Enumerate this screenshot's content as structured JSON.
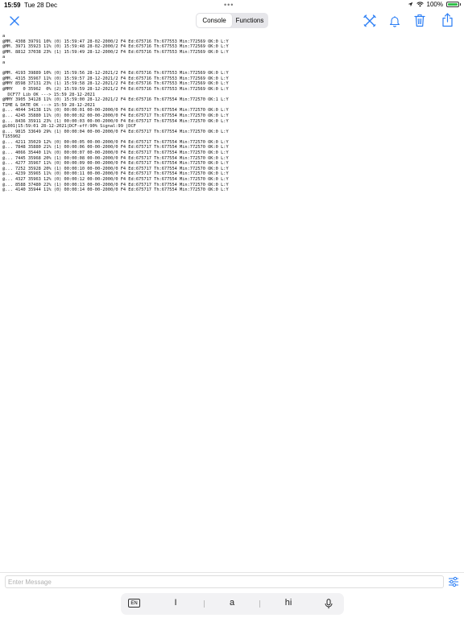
{
  "status_bar": {
    "time": "15:59",
    "date": "Tue 28 Dec",
    "battery": "100%",
    "battery_level": 1.0
  },
  "toolbar": {
    "tabs": [
      {
        "label": "Console",
        "active": true
      },
      {
        "label": "Functions",
        "active": false
      }
    ],
    "accent_color": "#2a7df5"
  },
  "console": {
    "lines": [
      "a",
      "@MM. 4308 39791 10% (0) 15:59:47 28-02-2000/2 F4 Ed:675716 Th:677553 Min:772569 OK:0 L:Y",
      "@MM. 3971 35923 11% (0) 15:59:48 28-02-2000/2 F4 Ed:675716 Th:677553 Min:772569 OK:0 L:Y",
      "@MM. 8812 37038 23% (1) 15:59:49 28-12-2000/2 F4 Ed:675716 Th:677553 Min:772569 OK:0 L:Y",
      "a",
      "a",
      "",
      "@MM. 4193 39889 10% (0) 15:59:56 28-12-2021/2 F4 Ed:675716 Th:677553 Min:772569 OK:0 L:Y",
      "@MM. 4315 35967 11% (0) 15:59:57 28-12-2021/2 F4 Ed:675716 Th:677553 Min:772569 OK:0 L:Y",
      "@MMY 8598 37131 23% (1) 15:59:58 28-12-2021/2 F4 Ed:675716 Th:677553 Min:772569 OK:0 L:Y",
      "@MMY    0 35962  0% (2) 15:59:59 28-12-2021/2 F4 Ed:675716 Th:677553 Min:772569 OK:0 L:Y",
      "  DCF77 Lib OK ---> 15:59 28-12-2021",
      "@MMY 3905 34128 11% (0) 15:59:00 28-12-2021/2 F4 Ed:675716 Th:677554 Min:772570 OK:1 L:Y",
      "TIME & DATE OK ---> 15:59 28-12-2021",
      "@... 4044 34138 11% (0) 00:00:01 00-00-2000/0 F4 Ed:675717 Th:677554 Min:772570 OK:0 L:Y",
      "@... 4245 35880 11% (0) 00:00:02 00-00-2000/0 F4 Ed:675717 Th:677554 Min:772570 OK:0 L:Y",
      "@... 8436 35911 23% (1) 00:00:03 00-00-2000/0 F4 Ed:675717 Th:677554 Min:772570 OK:0 L:Y",
      "@L001|15:59:01 28-12-2021|DCF-eff:90% Signal:99 |DCF",
      "@... 9815 33649 29% (1) 00:00:04 00-00-2000/0 F4 Ed:675717 Th:677554 Min:772570 OK:0 L:Y",
      "T155902",
      "@... 4211 35029 12% (0) 00:00:05 00-00-2000/0 F4 Ed:675717 Th:677554 Min:772570 OK:0 L:Y",
      "@... 7848 35880 21% (1) 00:00:06 00-00-2000/0 F4 Ed:675717 Th:677554 Min:772570 OK:0 L:Y",
      "@... 4066 35440 11% (0) 00:00:07 00-00-2000/0 F4 Ed:675717 Th:677554 Min:772570 OK:0 L:Y",
      "@... 7445 35968 20% (1) 00:00:08 00-00-2000/0 F4 Ed:675717 Th:677554 Min:772570 OK:0 L:Y",
      "@... 4277 35967 11% (0) 00:00:09 00-00-2000/0 F4 Ed:675717 Th:677554 Min:772570 OK:0 L:Y",
      "@... 7252 35928 20% (1) 00:00:10 00-00-2000/0 F4 Ed:675717 Th:677554 Min:772570 OK:0 L:Y",
      "@... 4239 35965 11% (0) 00:00:11 00-00-2000/0 F4 Ed:675717 Th:677554 Min:772570 OK:0 L:Y",
      "@... 4327 35963 12% (0) 00:00:12 00-00-2000/0 F4 Ed:675717 Th:677554 Min:772570 OK:0 L:Y",
      "@... 8588 37480 22% (1) 00:00:13 00-00-2000/0 F4 Ed:675717 Th:677554 Min:772570 OK:0 L:Y",
      "@... 4140 35944 11% (0) 00:00:14 00-00-2000/0 F4 Ed:675717 Th:677554 Min:772570 OK:0 L:Y"
    ]
  },
  "input": {
    "placeholder": "Enter Message",
    "value": ""
  },
  "keyboard": {
    "language": "EN",
    "suggestions": [
      "I",
      "a",
      "hi"
    ]
  },
  "icons": {
    "close": "close-icon",
    "tools": "tools-icon",
    "bell": "bell-icon",
    "trash": "trash-icon",
    "share": "share-icon",
    "sliders": "sliders-icon",
    "microphone": "microphone-icon",
    "location": "location-icon",
    "wifi": "wifi-icon",
    "battery": "battery-icon"
  }
}
